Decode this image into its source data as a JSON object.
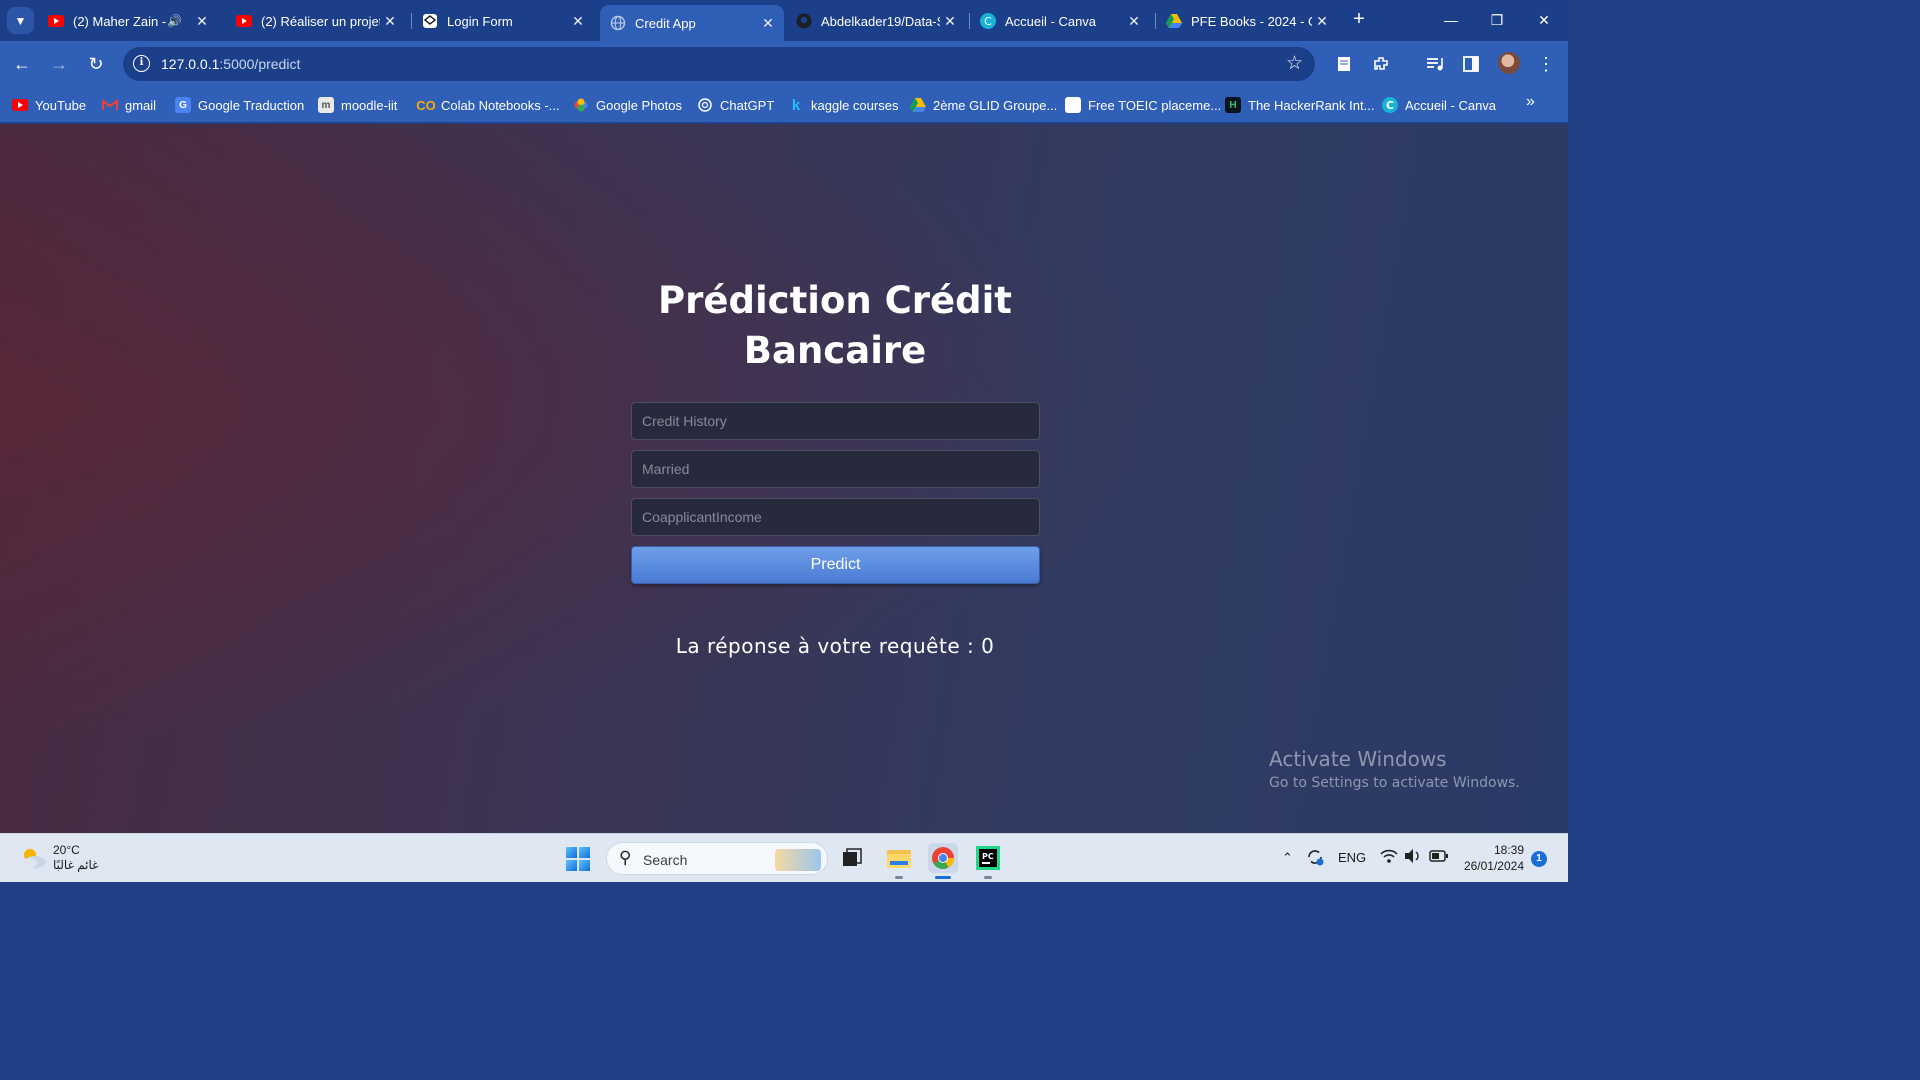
{
  "browser": {
    "tabs": [
      {
        "title": "(2) Maher Zain - I",
        "favicon": "youtube-icon",
        "audio": true,
        "active": false
      },
      {
        "title": "(2) Réaliser un projet",
        "favicon": "youtube-icon",
        "audio": false,
        "active": false
      },
      {
        "title": "Login Form",
        "favicon": "codepen-icon",
        "audio": false,
        "active": false
      },
      {
        "title": "Credit App",
        "favicon": "globe-icon",
        "audio": false,
        "active": true
      },
      {
        "title": "Abdelkader19/Data-S",
        "favicon": "github-icon",
        "audio": false,
        "active": false
      },
      {
        "title": "Accueil - Canva",
        "favicon": "canva-icon",
        "audio": false,
        "active": false
      },
      {
        "title": "PFE Books - 2024 - G",
        "favicon": "google-drive-icon",
        "audio": false,
        "active": false
      }
    ],
    "address": {
      "host": "127.0.0.1",
      "path": ":5000/predict"
    },
    "bookmarks": [
      {
        "label": "YouTube",
        "icon": "youtube-icon"
      },
      {
        "label": "gmail",
        "icon": "gmail-icon"
      },
      {
        "label": "Google Traduction",
        "icon": "google-translate-icon"
      },
      {
        "label": "moodle-iit",
        "icon": "moodle-icon"
      },
      {
        "label": "Colab Notebooks -...",
        "icon": "colab-icon"
      },
      {
        "label": "Google Photos",
        "icon": "google-photos-icon"
      },
      {
        "label": "ChatGPT",
        "icon": "chatgpt-icon"
      },
      {
        "label": "kaggle courses",
        "icon": "kaggle-icon"
      },
      {
        "label": "2ème GLID Groupe...",
        "icon": "google-drive-icon"
      },
      {
        "label": "Free TOEIC placeme...",
        "icon": "toeic-icon"
      },
      {
        "label": "The HackerRank Int...",
        "icon": "hackerrank-icon"
      },
      {
        "label": "Accueil - Canva",
        "icon": "canva-icon"
      }
    ]
  },
  "page": {
    "heading_line1": "Prédiction Crédit",
    "heading_line2": "Bancaire",
    "fields": {
      "credit_history_placeholder": "Credit History",
      "married_placeholder": "Married",
      "coapplicant_income_placeholder": "CoapplicantIncome"
    },
    "predict_label": "Predict",
    "result_text": "La réponse à votre requête : 0"
  },
  "watermark": {
    "title": "Activate Windows",
    "subtitle": "Go to Settings to activate Windows."
  },
  "taskbar": {
    "weather_temp": "20°C",
    "weather_desc": "غائم غالبًا",
    "search_label": "Search",
    "language": "ENG",
    "time": "18:39",
    "date": "26/01/2024",
    "notification_count": "1"
  },
  "colors": {
    "browser_frame": "#1c3f8a",
    "toolbar": "#2f5fb6",
    "predict_button": "#5a8ad9",
    "page_bg_start": "#4a2a3f",
    "page_bg_end": "#2a3a66"
  }
}
